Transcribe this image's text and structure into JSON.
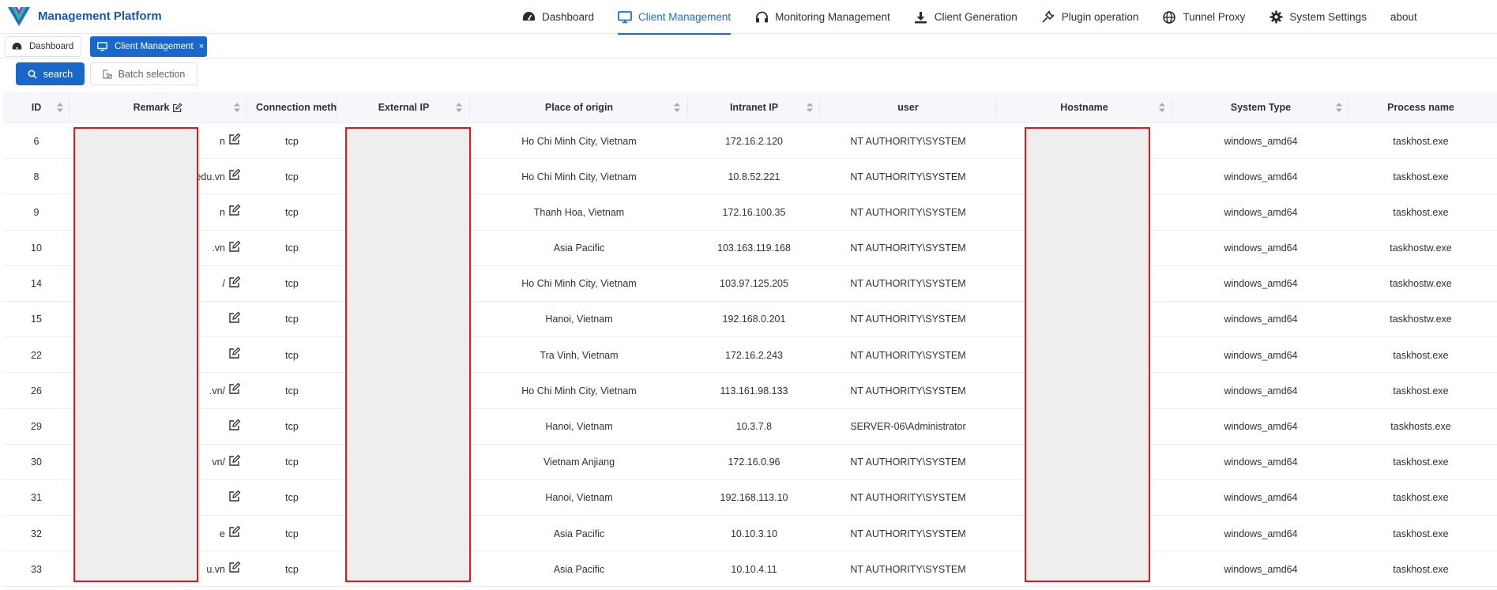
{
  "app": {
    "title": "Management Platform"
  },
  "nav": [
    {
      "label": "Dashboard",
      "icon": "dashboard-icon"
    },
    {
      "label": "Client Management",
      "icon": "monitor-icon",
      "active": true
    },
    {
      "label": "Monitoring Management",
      "icon": "headphones-icon"
    },
    {
      "label": "Client Generation",
      "icon": "download-icon"
    },
    {
      "label": "Plugin operation",
      "icon": "plugin-icon"
    },
    {
      "label": "Tunnel Proxy",
      "icon": "globe-icon"
    },
    {
      "label": "System Settings",
      "icon": "gear-icon"
    },
    {
      "label": "about"
    }
  ],
  "tabs": [
    {
      "label": "Dashboard",
      "icon": "dashboard-icon"
    },
    {
      "label": "Client Management",
      "icon": "monitor-icon",
      "active": true,
      "close": "×"
    }
  ],
  "toolbar": {
    "search_label": "search",
    "batch_label": "Batch selection"
  },
  "table": {
    "columns": [
      "ID",
      "Remark",
      "Connection method",
      "External IP",
      "Place of origin",
      "Intranet IP",
      "user",
      "Hostname",
      "System Type",
      "Process name"
    ],
    "rows": [
      {
        "id": "6",
        "remark": "n",
        "conn": "tcp",
        "origin": "Ho Chi Minh City, Vietnam",
        "intranet_ip": "172.16.2.120",
        "user": "NT AUTHORITY\\SYSTEM",
        "system_type": "windows_amd64",
        "process": "taskhost.exe"
      },
      {
        "id": "8",
        "remark": ".edu.vn",
        "conn": "tcp",
        "origin": "Ho Chi Minh City, Vietnam",
        "intranet_ip": "10.8.52.221",
        "user": "NT AUTHORITY\\SYSTEM",
        "system_type": "windows_amd64",
        "process": "taskhost.exe"
      },
      {
        "id": "9",
        "remark": "n",
        "conn": "tcp",
        "origin": "Thanh Hoa, Vietnam",
        "intranet_ip": "172.16.100.35",
        "user": "NT AUTHORITY\\SYSTEM",
        "system_type": "windows_amd64",
        "process": "taskhost.exe"
      },
      {
        "id": "10",
        "remark": ".vn",
        "conn": "tcp",
        "origin": "Asia Pacific",
        "intranet_ip": "103.163.119.168",
        "user": "NT AUTHORITY\\SYSTEM",
        "system_type": "windows_amd64",
        "process": "taskhostw.exe"
      },
      {
        "id": "14",
        "remark": "/",
        "conn": "tcp",
        "origin": "Ho Chi Minh City, Vietnam",
        "intranet_ip": "103.97.125.205",
        "user": "NT AUTHORITY\\SYSTEM",
        "system_type": "windows_amd64",
        "process": "taskhostw.exe"
      },
      {
        "id": "15",
        "remark": "",
        "conn": "tcp",
        "origin": "Hanoi, Vietnam",
        "intranet_ip": "192.168.0.201",
        "user": "NT AUTHORITY\\SYSTEM",
        "system_type": "windows_amd64",
        "process": "taskhostw.exe"
      },
      {
        "id": "22",
        "remark": "",
        "conn": "tcp",
        "origin": "Tra Vinh, Vietnam",
        "intranet_ip": "172.16.2.243",
        "user": "NT AUTHORITY\\SYSTEM",
        "system_type": "windows_amd64",
        "process": "taskhost.exe"
      },
      {
        "id": "26",
        "remark": ".vn/",
        "conn": "tcp",
        "origin": "Ho Chi Minh City, Vietnam",
        "intranet_ip": "113.161.98.133",
        "user": "NT AUTHORITY\\SYSTEM",
        "system_type": "windows_amd64",
        "process": "taskhost.exe"
      },
      {
        "id": "29",
        "remark": "",
        "conn": "tcp",
        "origin": "Hanoi, Vietnam",
        "intranet_ip": "10.3.7.8",
        "user": "SERVER-06\\Administrator",
        "system_type": "windows_amd64",
        "process": "taskhosts.exe"
      },
      {
        "id": "30",
        "remark": "vn/",
        "conn": "tcp",
        "origin": "Vietnam Anjiang",
        "intranet_ip": "172.16.0.96",
        "user": "NT AUTHORITY\\SYSTEM",
        "system_type": "windows_amd64",
        "process": "taskhost.exe"
      },
      {
        "id": "31",
        "remark": "",
        "conn": "tcp",
        "origin": "Hanoi, Vietnam",
        "intranet_ip": "192.168.113.10",
        "user": "NT AUTHORITY\\SYSTEM",
        "system_type": "windows_amd64",
        "process": "taskhost.exe"
      },
      {
        "id": "32",
        "remark": "e",
        "conn": "tcp",
        "origin": "Asia Pacific",
        "intranet_ip": "10.10.3.10",
        "user": "NT AUTHORITY\\SYSTEM",
        "system_type": "windows_amd64",
        "process": "taskhost.exe"
      },
      {
        "id": "33",
        "remark": "u.vn",
        "conn": "tcp",
        "origin": "Asia Pacific",
        "intranet_ip": "10.10.4.11",
        "user": "NT AUTHORITY\\SYSTEM",
        "system_type": "windows_amd64",
        "process": "taskhost.exe"
      }
    ]
  },
  "colors": {
    "accent": "#1a6fd4",
    "tab_active": "#1967c8",
    "redaction_border": "#e01818"
  }
}
